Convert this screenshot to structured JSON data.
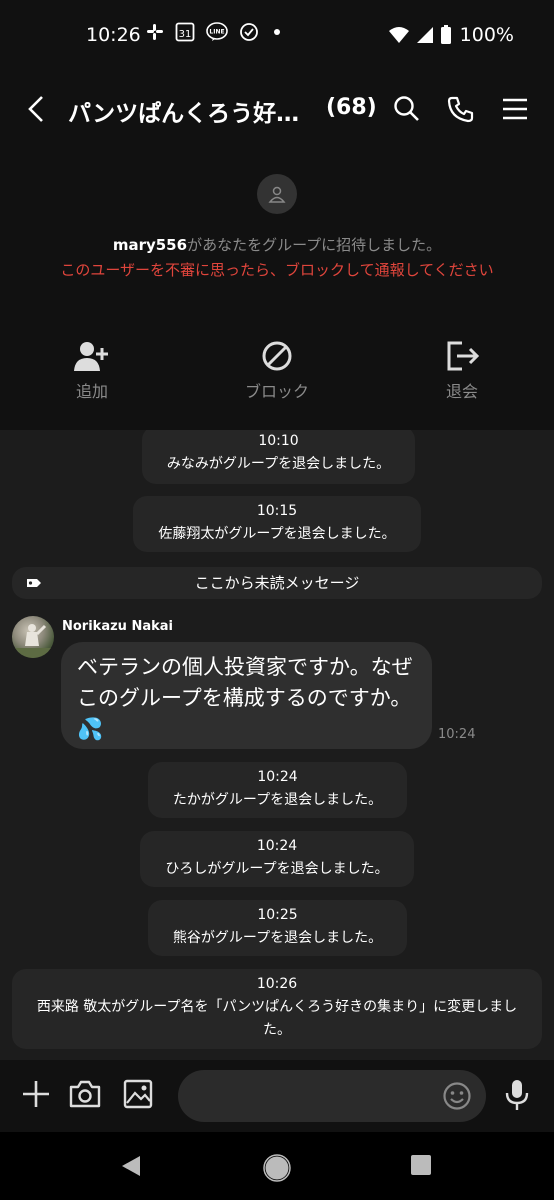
{
  "status_bar": {
    "time": "10:26",
    "calendar_day": "31",
    "line_badge": "LINE",
    "battery": "100%"
  },
  "header": {
    "title": "パンツぱんくろう好…",
    "member_count": "(68)"
  },
  "group_info": {
    "inviter": "mary556",
    "invite_text": "があなたをグループに招待しました。",
    "warning": "このユーザーを不審に思ったら、ブロックして通報してください",
    "actions": {
      "add": "追加",
      "block": "ブロック",
      "leave": "退会"
    }
  },
  "messages": {
    "sys1": {
      "time": "10:10",
      "text": "みなみがグループを退会しました。"
    },
    "sys2": {
      "time": "10:15",
      "text": "佐藤翔太がグループを退会しました。"
    },
    "unread": "ここから未読メッセージ",
    "chat1": {
      "sender": "Norikazu Nakai",
      "text": "ベテランの個人投資家ですか。なぜこのグループを構成するのですか。💦",
      "time": "10:24"
    },
    "sys3": {
      "time": "10:24",
      "text": "たかがグループを退会しました。"
    },
    "sys4": {
      "time": "10:24",
      "text": "ひろしがグループを退会しました。"
    },
    "sys5": {
      "time": "10:25",
      "text": "熊谷がグループを退会しました。"
    },
    "sys6": {
      "time": "10:26",
      "text": "西来路 敬太がグループ名を「パンツぱんくろう好きの集まり」に変更しました。"
    }
  },
  "colors": {
    "warning_red": "#e0453c",
    "background": "#1c1c1c",
    "header_bg": "#111111",
    "bubble": "#2f2f2f",
    "system_pill": "#262626"
  }
}
